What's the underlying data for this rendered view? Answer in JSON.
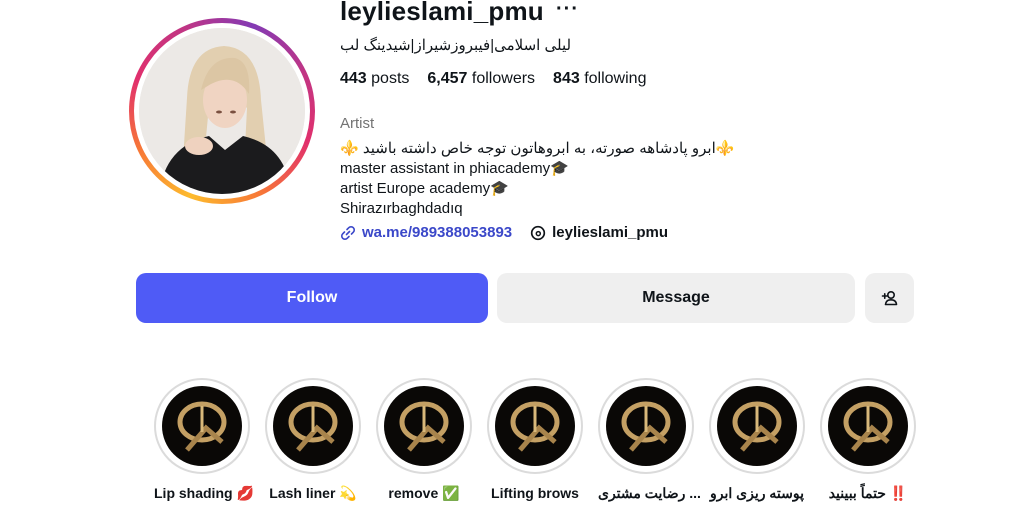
{
  "profile": {
    "username": "leylieslami_pmu",
    "more_label": "···",
    "full_name": "لیلی اسلامی|فیبروزشیراز|شیدینگ لب",
    "stats": {
      "posts_count": "443",
      "posts_label": "posts",
      "followers_count": "6,457",
      "followers_label": "followers",
      "following_count": "843",
      "following_label": "following"
    },
    "category": "Artist",
    "bio": [
      "⚜️ابرو پادشاهه صورته، به ابروهاتون توجه خاص داشته باشید ⚜️",
      "master assistant in phiacademy🎓",
      "artist Europe academy🎓",
      "Shirazırbaghdadıq"
    ],
    "link_url": "wa.me/989388053893",
    "threads_handle": "leylieslami_pmu"
  },
  "actions": {
    "follow_label": "Follow",
    "message_label": "Message"
  },
  "highlights": [
    {
      "label": "Lip shading 💋"
    },
    {
      "label": "Lash liner 💫"
    },
    {
      "label": "remove ✅"
    },
    {
      "label": "Lifting brows"
    },
    {
      "label": "رضایت مشتری ..."
    },
    {
      "label": "پوسته ریزی ابرو"
    },
    {
      "label": "حتماً ببینید ‼️"
    }
  ],
  "colors": {
    "follow_button": "#4f5bf6",
    "link": "#3b48c9",
    "secondary_button": "#efefef"
  },
  "icons": [
    "more-options-icon",
    "link-icon",
    "threads-icon",
    "add-person-icon"
  ]
}
